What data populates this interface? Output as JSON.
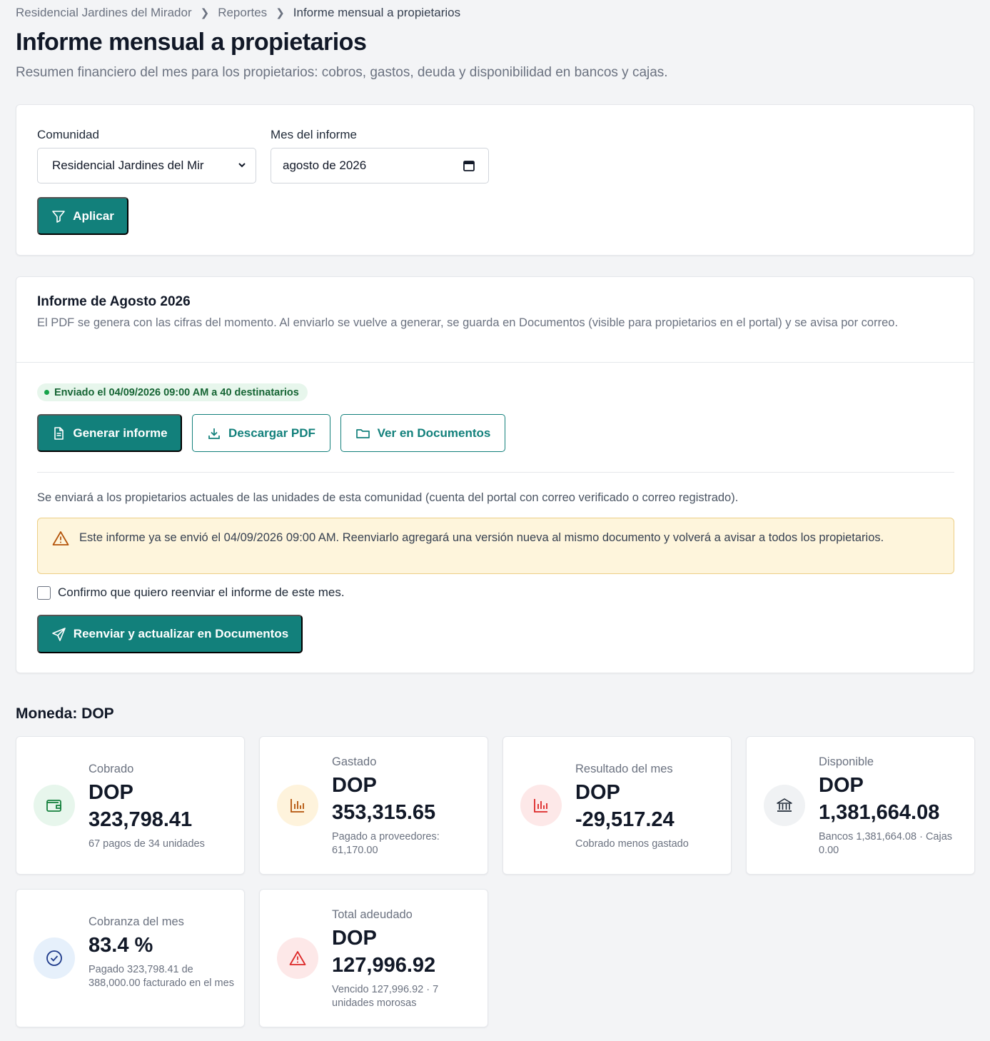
{
  "breadcrumb": {
    "items": [
      "Residencial Jardines del Mirador",
      "Reportes",
      "Informe mensual a propietarios"
    ]
  },
  "page": {
    "title": "Informe mensual a propietarios",
    "subtitle": "Resumen financiero del mes para los propietarios: cobros, gastos, deuda y disponibilidad en bancos y cajas."
  },
  "filters": {
    "community_label": "Comunidad",
    "community_value": "Residencial Jardines del Mir",
    "month_label": "Mes del informe",
    "month_value": "agosto de 2026",
    "apply_label": "Aplicar"
  },
  "report": {
    "title": "Informe de Agosto 2026",
    "description": "El PDF se genera con las cifras del momento. Al enviarlo se vuelve a generar, se guarda en Documentos (visible para propietarios en el portal) y se avisa por correo.",
    "status": "Enviado el 04/09/2026 09:00 AM a 40 destinatarios",
    "generate_label": "Generar informe",
    "download_label": "Descargar PDF",
    "docs_label": "Ver en Documentos",
    "send_note": "Se enviará a los propietarios actuales de las unidades de esta comunidad (cuenta del portal con correo verificado o correo registrado).",
    "warning": "Este informe ya se envió el 04/09/2026 09:00 AM. Reenviarlo agregará una versión nueva al mismo documento y volverá a avisar a todos los propietarios.",
    "confirm_label": "Confirmo que quiero reenviar el informe de este mes.",
    "resend_label": "Reenviar y actualizar en Documentos"
  },
  "currency": {
    "title": "Moneda: DOP"
  },
  "kpis": {
    "cobrado": {
      "label": "Cobrado",
      "currency": "DOP",
      "value": "323,798.41",
      "sub": "67 pagos de 34 unidades"
    },
    "gastado": {
      "label": "Gastado",
      "currency": "DOP",
      "value": "353,315.65",
      "sub": "Pagado a proveedores: 61,170.00"
    },
    "resultado": {
      "label": "Resultado del mes",
      "currency": "DOP",
      "value": "-29,517.24",
      "sub": "Cobrado menos gastado"
    },
    "disponible": {
      "label": "Disponible",
      "currency": "DOP",
      "value": "1,381,664.08",
      "sub": "Bancos 1,381,664.08 · Cajas 0.00"
    },
    "cobranza": {
      "label": "Cobranza del mes",
      "value": "83.4 %",
      "sub": "Pagado 323,798.41 de 388,000.00 facturado en el mes"
    },
    "adeudado": {
      "label": "Total adeudado",
      "currency": "DOP",
      "value": "127,996.92",
      "sub": "Vencido 127,996.92 · 7 unidades morosas"
    }
  },
  "colors": {
    "primary": "#12807b",
    "warning_bg": "#fef5dc",
    "success": "#16a34a",
    "danger": "#dc2626",
    "amber": "#d97706"
  }
}
